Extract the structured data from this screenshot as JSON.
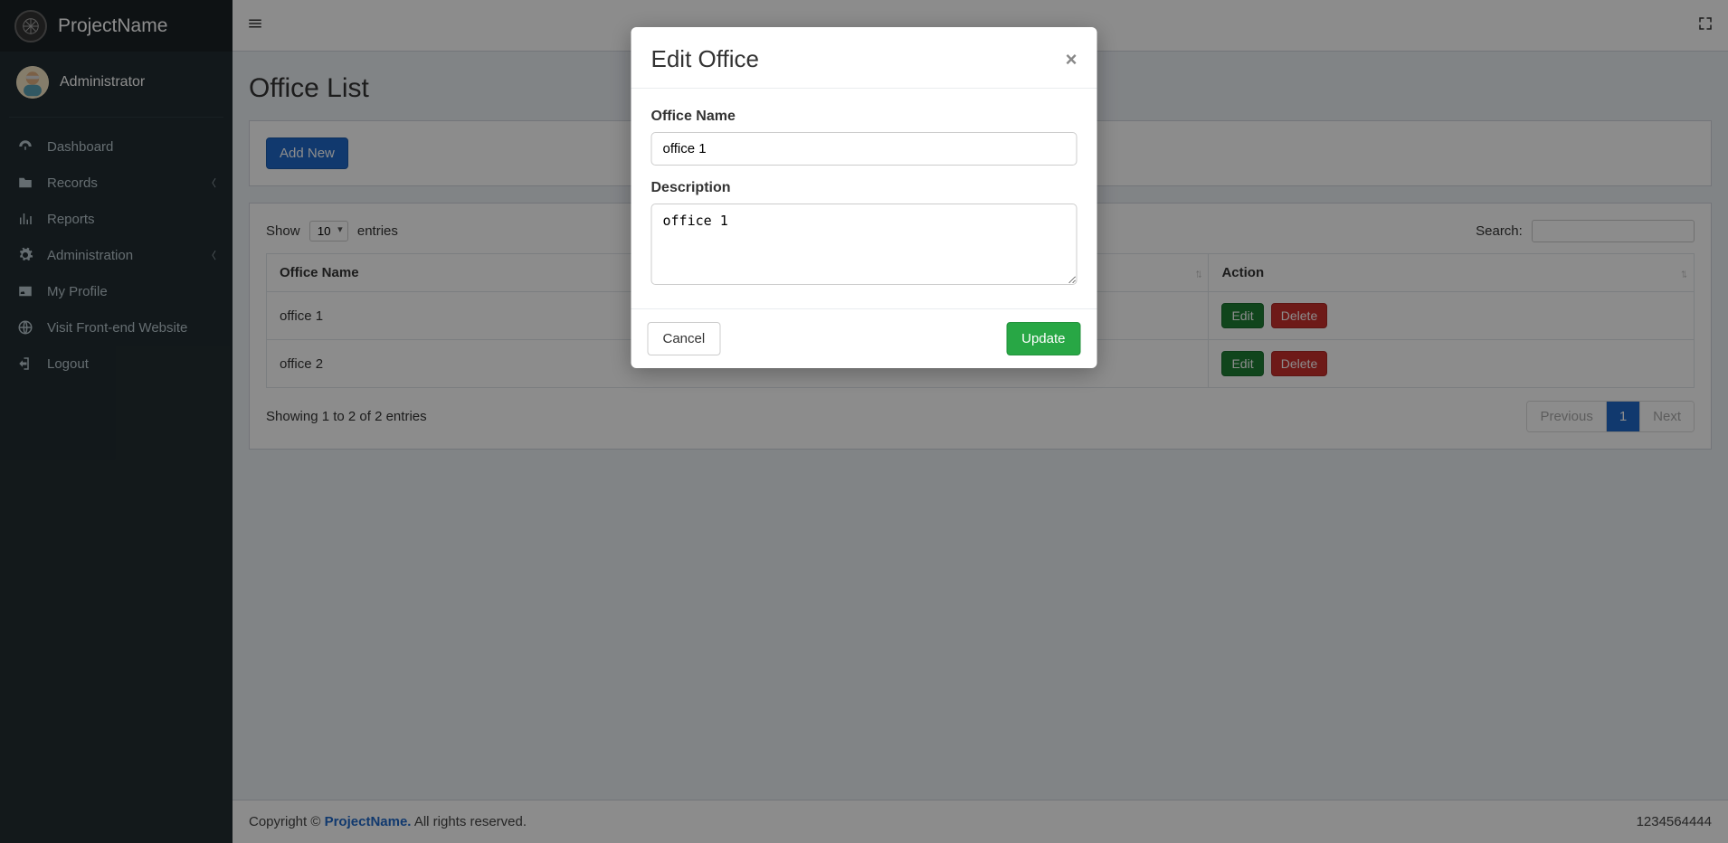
{
  "brand": {
    "name": "ProjectName"
  },
  "user": {
    "name": "Administrator"
  },
  "nav": {
    "dashboard": "Dashboard",
    "records": "Records",
    "reports": "Reports",
    "administration": "Administration",
    "profile": "My Profile",
    "frontend": "Visit Front-end Website",
    "logout": "Logout"
  },
  "page": {
    "title": "Office List",
    "add_new": "Add New"
  },
  "datatable": {
    "length": {
      "prefix": "Show",
      "value": "10",
      "suffix": "entries"
    },
    "search_label": "Search:",
    "search_value": "",
    "columns": {
      "name": "Office Name",
      "action": "Action"
    },
    "rows": [
      {
        "name": "office 1"
      },
      {
        "name": "office 2"
      }
    ],
    "row_actions": {
      "edit": "Edit",
      "delete": "Delete"
    },
    "info": "Showing 1 to 2 of 2 entries",
    "pagination": {
      "previous": "Previous",
      "page": "1",
      "next": "Next"
    }
  },
  "modal": {
    "title": "Edit Office",
    "name_label": "Office Name",
    "name_value": "office 1",
    "desc_label": "Description",
    "desc_value": "office 1",
    "cancel": "Cancel",
    "update": "Update"
  },
  "footer": {
    "copyright_prefix": "Copyright © ",
    "brand": "ProjectName.",
    "rights": " All rights reserved.",
    "number": "1234564444"
  }
}
